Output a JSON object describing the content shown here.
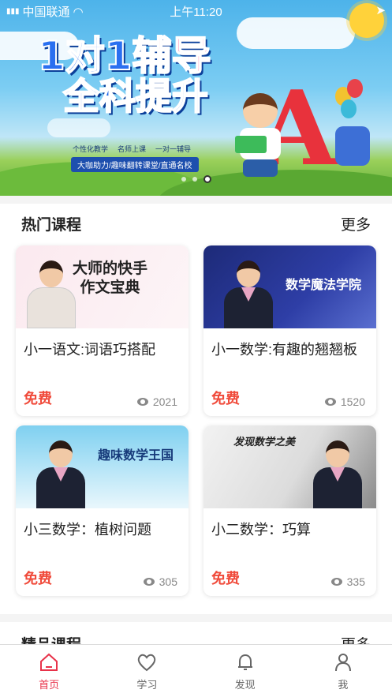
{
  "status_bar": {
    "carrier": "中国联通",
    "time": "上午11:20"
  },
  "banner": {
    "title_line1_a": "1对1",
    "title_line1_b": "辅导",
    "title_line2": "全科提升",
    "tags": [
      "个性化教学",
      "名师上课",
      "一对一辅导"
    ],
    "subtitle": "大咖助力/趣味翻转课堂/直通名校",
    "slide_count": 3,
    "active_slide": 3
  },
  "hot_courses": {
    "title": "热门课程",
    "more": "更多",
    "items": [
      {
        "thumb_text": "大师的快手\n作文宝典",
        "title": "小一语文:词语巧搭配",
        "price": "免费",
        "views": "2021"
      },
      {
        "thumb_text": "数学魔法学院",
        "title": "小一数学:有趣的翘翘板",
        "price": "免费",
        "views": "1520"
      },
      {
        "thumb_text": "趣味数学王国",
        "title": "小三数学：植树问题",
        "price": "免费",
        "views": "305"
      },
      {
        "thumb_text": "发现数学之美",
        "title": "小二数学：巧算",
        "price": "免费",
        "views": "335"
      }
    ]
  },
  "premium_courses": {
    "title": "精品课程",
    "more": "更多"
  },
  "tabbar": {
    "items": [
      {
        "label": "首页",
        "icon": "home-icon",
        "active": true
      },
      {
        "label": "学习",
        "icon": "heart-icon",
        "active": false
      },
      {
        "label": "发现",
        "icon": "bell-icon",
        "active": false
      },
      {
        "label": "我",
        "icon": "user-icon",
        "active": false
      }
    ]
  },
  "colors": {
    "accent": "#e8324a",
    "price": "#f04a3a"
  }
}
